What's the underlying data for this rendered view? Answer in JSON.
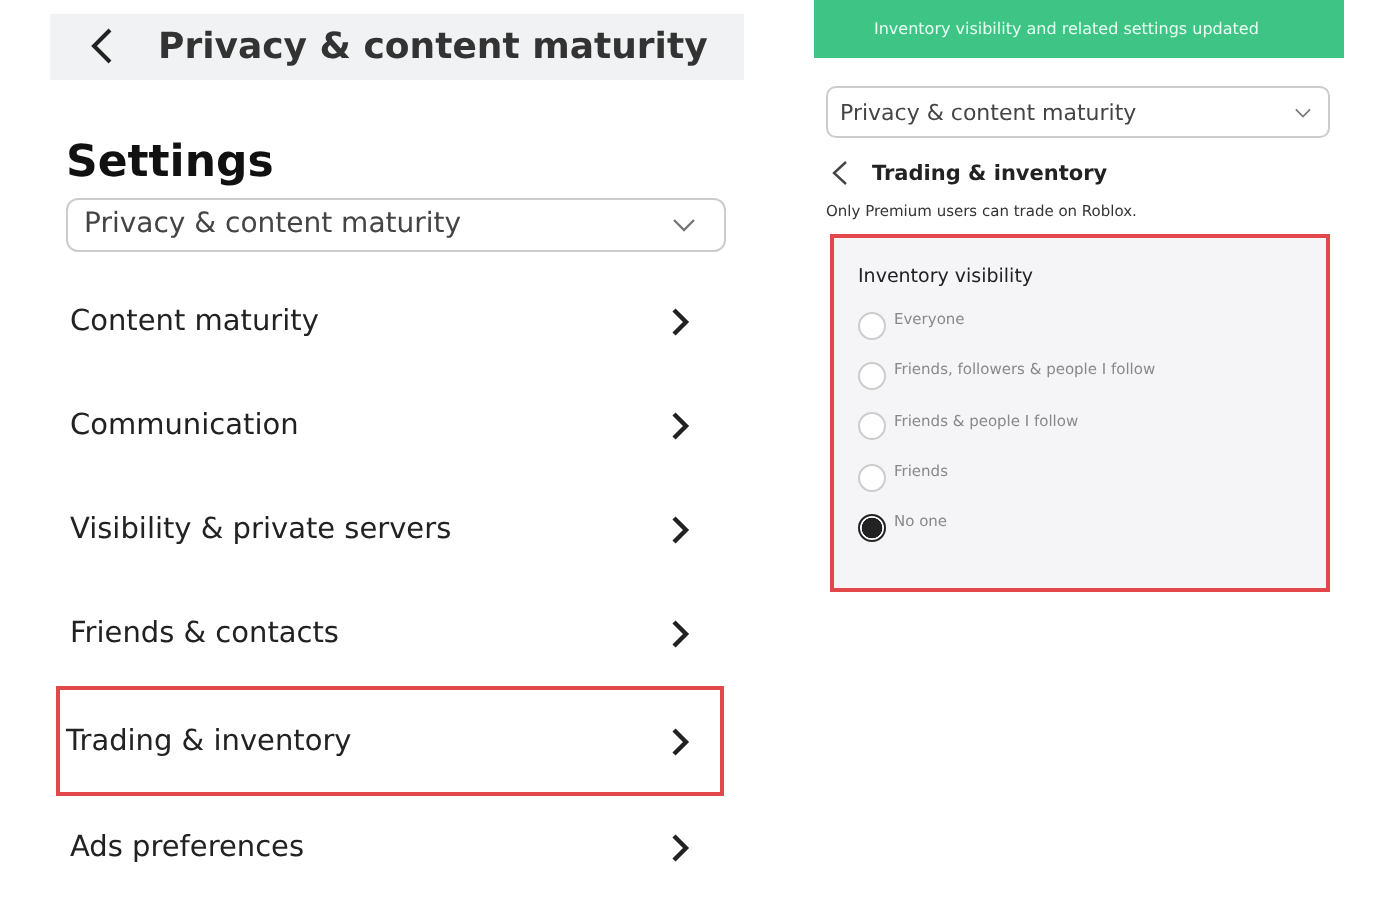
{
  "left": {
    "header": {
      "title": "Privacy & content maturity"
    },
    "heading": "Settings",
    "dropdown": {
      "value": "Privacy & content maturity"
    },
    "items": [
      {
        "label": "Content maturity",
        "highlighted": false
      },
      {
        "label": "Communication",
        "highlighted": false
      },
      {
        "label": "Visibility & private servers",
        "highlighted": false
      },
      {
        "label": "Friends & contacts",
        "highlighted": false
      },
      {
        "label": "Trading & inventory",
        "highlighted": true
      },
      {
        "label": "Ads preferences",
        "highlighted": false
      }
    ]
  },
  "right": {
    "toast": "Inventory visibility and related settings updated",
    "dropdown": {
      "value": "Privacy & content maturity"
    },
    "title": "Trading & inventory",
    "note": "Only Premium users can trade on Roblox.",
    "panel": {
      "highlighted": true,
      "label": "Inventory visibility",
      "options": [
        {
          "label": "Everyone",
          "selected": false
        },
        {
          "label": "Friends, followers & people I follow",
          "selected": false
        },
        {
          "label": "Friends & people I follow",
          "selected": false
        },
        {
          "label": "Friends",
          "selected": false
        },
        {
          "label": "No one",
          "selected": true
        }
      ]
    }
  }
}
